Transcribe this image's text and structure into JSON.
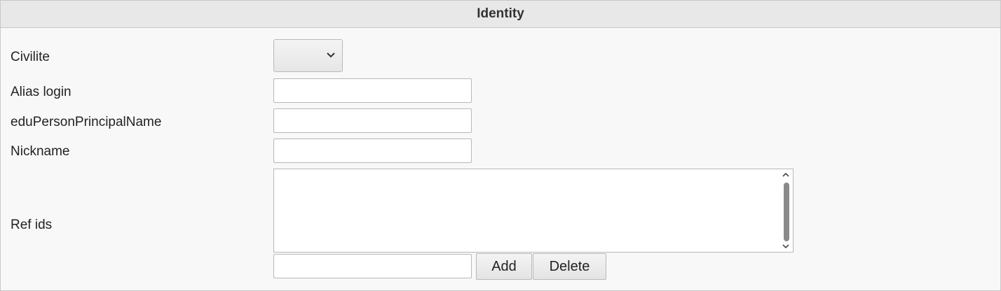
{
  "panel": {
    "title": "Identity"
  },
  "fields": {
    "civilite": {
      "label": "Civilite",
      "selected": ""
    },
    "alias_login": {
      "label": "Alias login",
      "value": ""
    },
    "edu_person_principal_name": {
      "label": "eduPersonPrincipalName",
      "value": ""
    },
    "nickname": {
      "label": "Nickname",
      "value": ""
    },
    "ref_ids": {
      "label": "Ref ids",
      "items": [],
      "new_value": "",
      "add_label": "Add",
      "delete_label": "Delete"
    }
  },
  "icons": {
    "select_arrow": "chevron-down-icon",
    "scroll_up": "chevron-up-icon",
    "scroll_down": "chevron-down-icon"
  },
  "colors": {
    "header_bg": "#e8e8e8",
    "panel_bg": "#f8f8f8",
    "border": "#c8c8c8",
    "scroll_thumb": "#8a8a8a"
  }
}
